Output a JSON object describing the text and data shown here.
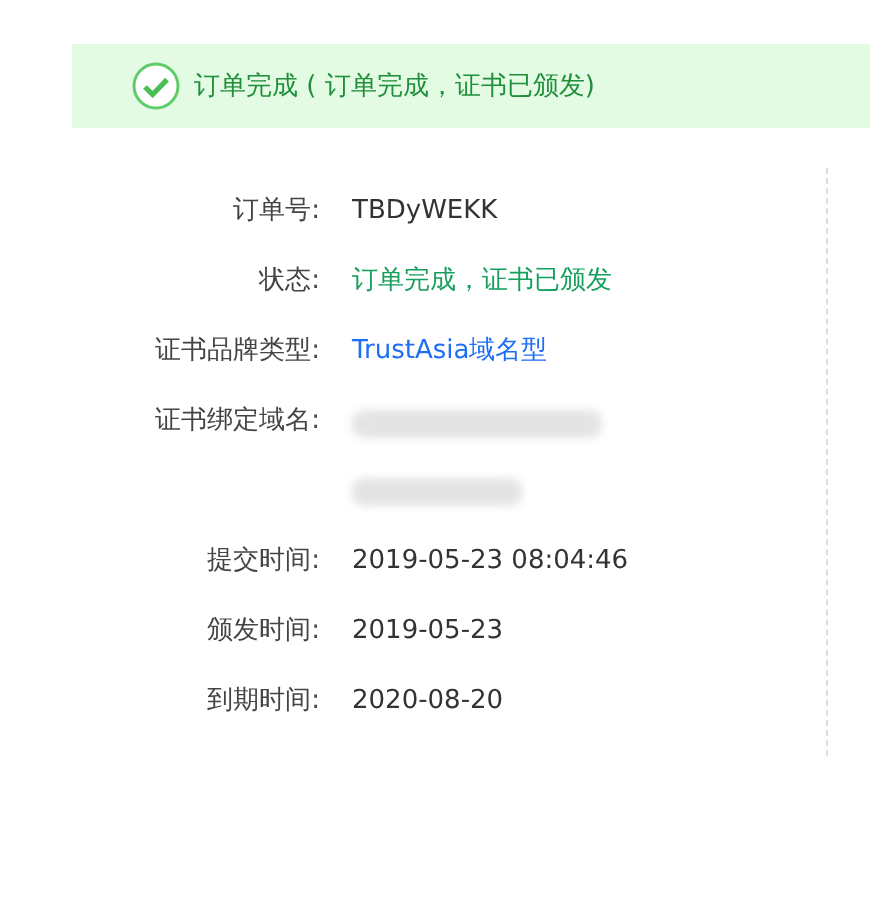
{
  "banner": {
    "success": true,
    "text": "订单完成 ( 订单完成，证书已颁发)"
  },
  "details": [
    {
      "label": "订单号:",
      "kind": "text",
      "value": "TBDyWEKK"
    },
    {
      "label": "状态:",
      "kind": "status",
      "value": "订单完成，证书已颁发"
    },
    {
      "label": "证书品牌类型:",
      "kind": "link",
      "value": "TrustAsia域名型"
    },
    {
      "label": "证书绑定域名:",
      "kind": "redacted"
    },
    {
      "label": "提交时间:",
      "kind": "text",
      "value": "2019-05-23 08:04:46"
    },
    {
      "label": "颁发时间:",
      "kind": "text",
      "value": "2019-05-23"
    },
    {
      "label": "到期时间:",
      "kind": "text",
      "value": "2020-08-20"
    }
  ]
}
